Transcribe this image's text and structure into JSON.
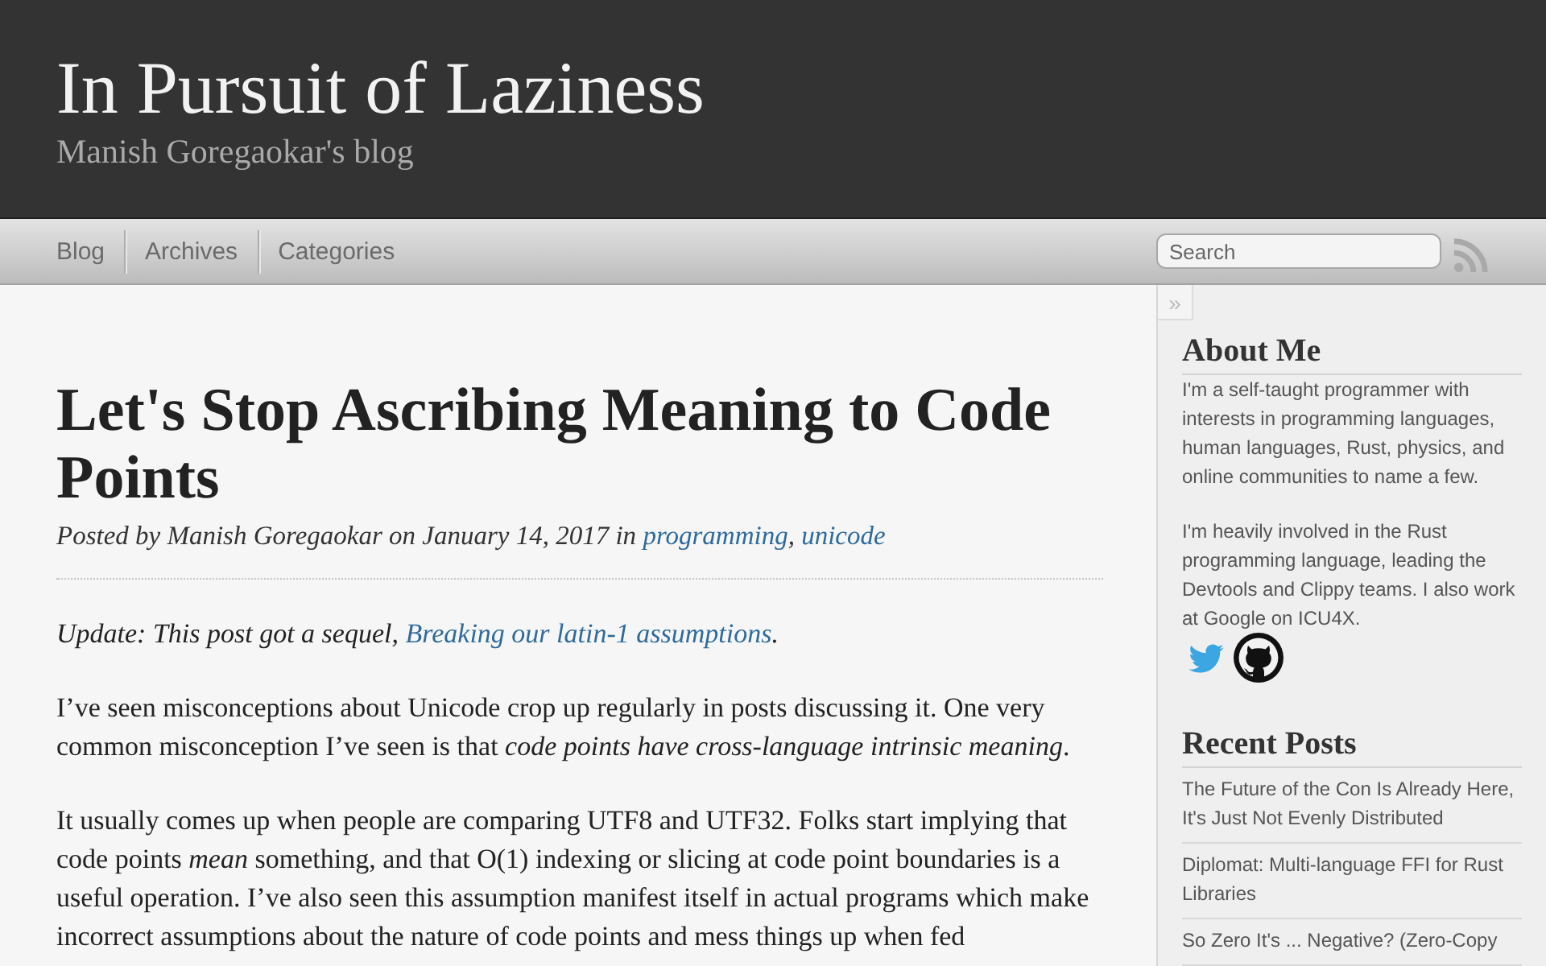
{
  "header": {
    "title": "In Pursuit of Laziness",
    "subtitle": "Manish Goregaokar's blog"
  },
  "nav": {
    "links": [
      "Blog",
      "Archives",
      "Categories"
    ],
    "search": {
      "placeholder": "Search"
    }
  },
  "article": {
    "title": "Let's Stop Ascribing Meaning to Code Points",
    "meta": [
      {
        "kind": "text",
        "text": "Posted by Manish Goregaokar on January 14, 2017 in "
      },
      {
        "kind": "link",
        "text": "programming"
      },
      {
        "kind": "text",
        "text": ", "
      },
      {
        "kind": "link",
        "text": "unicode"
      }
    ],
    "paragraphs": [
      {
        "kind": "note",
        "parts": [
          {
            "kind": "text",
            "text": "Update: This post got a sequel, "
          },
          {
            "kind": "link",
            "text": "Breaking our latin-1 assumptions"
          },
          {
            "kind": "text",
            "text": "."
          }
        ]
      },
      {
        "kind": "body",
        "parts": [
          {
            "kind": "text",
            "text": "I’ve seen misconceptions about Unicode crop up regularly in posts discussing it. One very common misconception I’ve seen is that *code points have cross-language intrinsic meaning*."
          }
        ]
      },
      {
        "kind": "body",
        "parts": [
          {
            "kind": "text",
            "text": "It usually comes up when people are comparing UTF8 and UTF32. Folks start implying that code points *mean* something, and that O(1) indexing or slicing at code point boundaries is a useful operation. I’ve also seen this assumption manifest itself in actual programs which make incorrect assumptions about the nature of code points and mess things up when fed"
          }
        ]
      }
    ]
  },
  "sidebar": {
    "toggle": "»",
    "about": {
      "heading": "About Me",
      "paragraphs": [
        "I'm a self-taught programmer with interests in programming languages, human languages, Rust, physics, and online communities to name a few.",
        "I'm heavily involved in the Rust programming language, leading the Devtools and Clippy teams. I also work at Google on ICU4X."
      ]
    },
    "recent": {
      "heading": "Recent Posts",
      "posts": [
        "The Future of the Con Is Already Here, It's Just Not Evenly Distributed",
        "Diplomat: Multi-language FFI for Rust Libraries",
        "So Zero It's ... Negative? (Zero-Copy"
      ]
    }
  }
}
